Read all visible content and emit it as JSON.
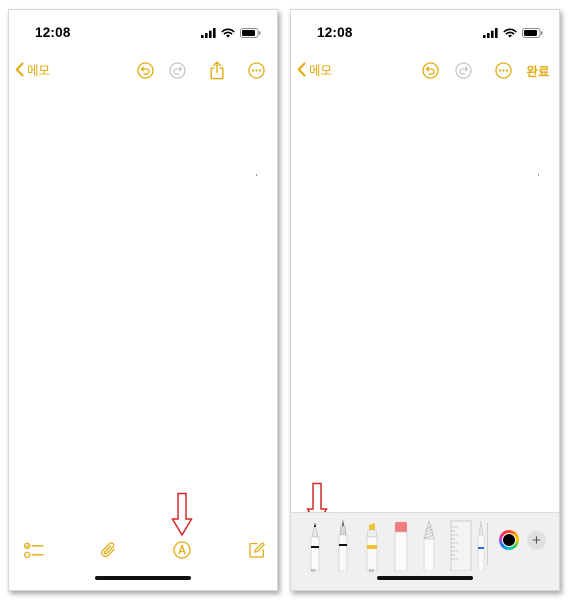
{
  "colors": {
    "accent": "#e3aa13",
    "annotation_arrow": "#d42a2a"
  },
  "left_screen": {
    "status": {
      "time": "12:08"
    },
    "nav": {
      "back_label": "메모",
      "buttons": [
        "back-chevron-icon",
        "undo-icon",
        "redo-icon",
        "share-icon",
        "more-icon"
      ]
    },
    "toolbar": {
      "buttons": [
        "checklist-icon",
        "paperclip-icon",
        "markup-pen-icon",
        "compose-icon"
      ]
    }
  },
  "right_screen": {
    "status": {
      "time": "12:08"
    },
    "nav": {
      "back_label": "메모",
      "done_label": "완료",
      "buttons": [
        "back-chevron-icon",
        "undo-icon",
        "redo-icon",
        "more-icon"
      ]
    },
    "drawing_tools": [
      "pen-tool",
      "fineliner-tool",
      "highlighter-tool",
      "eraser-tool",
      "lasso-tool",
      "ruler-tool",
      "color-picker",
      "add-tool-button"
    ],
    "tool_labels": {
      "pen": "97",
      "highlighter": "50"
    }
  }
}
